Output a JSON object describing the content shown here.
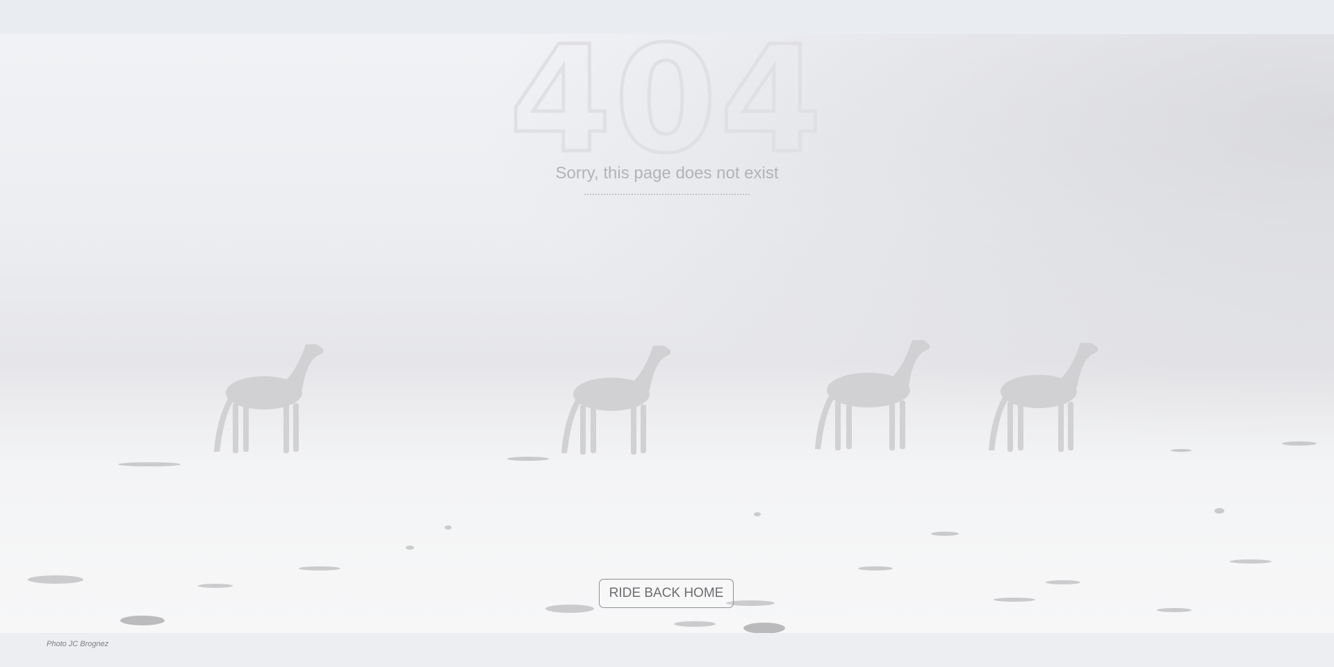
{
  "error": {
    "code": "404",
    "message": "Sorry, this page does not exist"
  },
  "actions": {
    "home_button_label": "RIDE BACK HOME"
  },
  "footer": {
    "credit": "Photo JC Brognez"
  },
  "colors": {
    "background": "#e9ecf0",
    "fog": "#f1f2f5",
    "snow": "#f7f7f8",
    "horse": "#d1d1d4",
    "button_border": "#8e8e92",
    "button_text": "#6c6c70",
    "message_text": "#b3b3b7"
  }
}
